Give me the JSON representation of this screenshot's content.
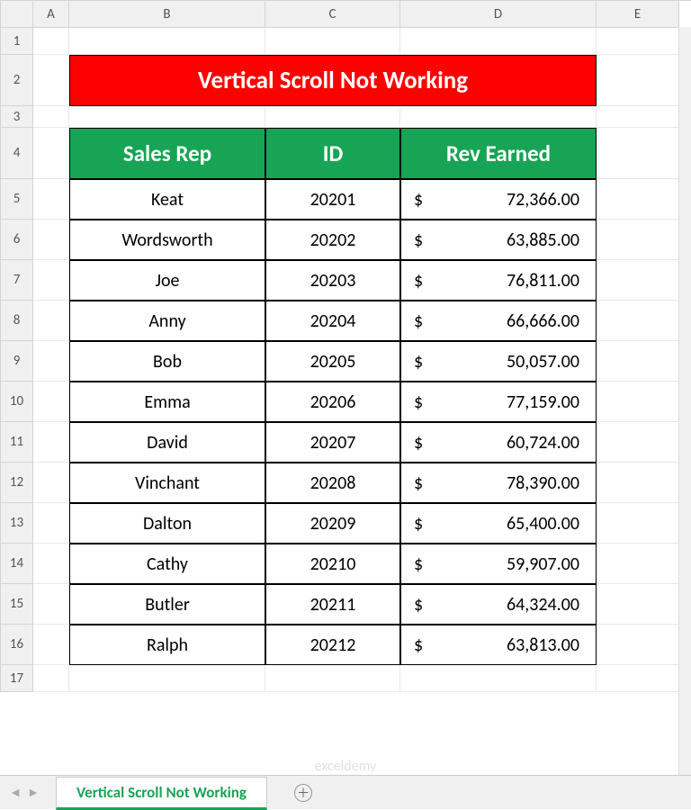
{
  "columns": [
    "A",
    "B",
    "C",
    "D",
    "E"
  ],
  "row_numbers": [
    1,
    2,
    3,
    4,
    5,
    6,
    7,
    8,
    9,
    10,
    11,
    12,
    13,
    14,
    15,
    16,
    17
  ],
  "title": "Vertical Scroll Not Working",
  "headers": {
    "rep": "Sales Rep",
    "id": "ID",
    "rev": "Rev Earned"
  },
  "currency": "$",
  "rows": [
    {
      "rep": "Keat",
      "id": "20201",
      "rev": "72,366.00"
    },
    {
      "rep": "Wordsworth",
      "id": "20202",
      "rev": "63,885.00"
    },
    {
      "rep": "Joe",
      "id": "20203",
      "rev": "76,811.00"
    },
    {
      "rep": "Anny",
      "id": "20204",
      "rev": "66,666.00"
    },
    {
      "rep": "Bob",
      "id": "20205",
      "rev": "50,057.00"
    },
    {
      "rep": "Emma",
      "id": "20206",
      "rev": "77,159.00"
    },
    {
      "rep": "David",
      "id": "20207",
      "rev": "60,724.00"
    },
    {
      "rep": "Vinchant",
      "id": "20208",
      "rev": "78,390.00"
    },
    {
      "rep": "Dalton",
      "id": "20209",
      "rev": "65,400.00"
    },
    {
      "rep": "Cathy",
      "id": "20210",
      "rev": "59,907.00"
    },
    {
      "rep": "Butler",
      "id": "20211",
      "rev": "64,324.00"
    },
    {
      "rep": "Ralph",
      "id": "20212",
      "rev": "63,813.00"
    }
  ],
  "sheet_tab": "Vertical Scroll Not Working",
  "watermark": "exceldemy"
}
